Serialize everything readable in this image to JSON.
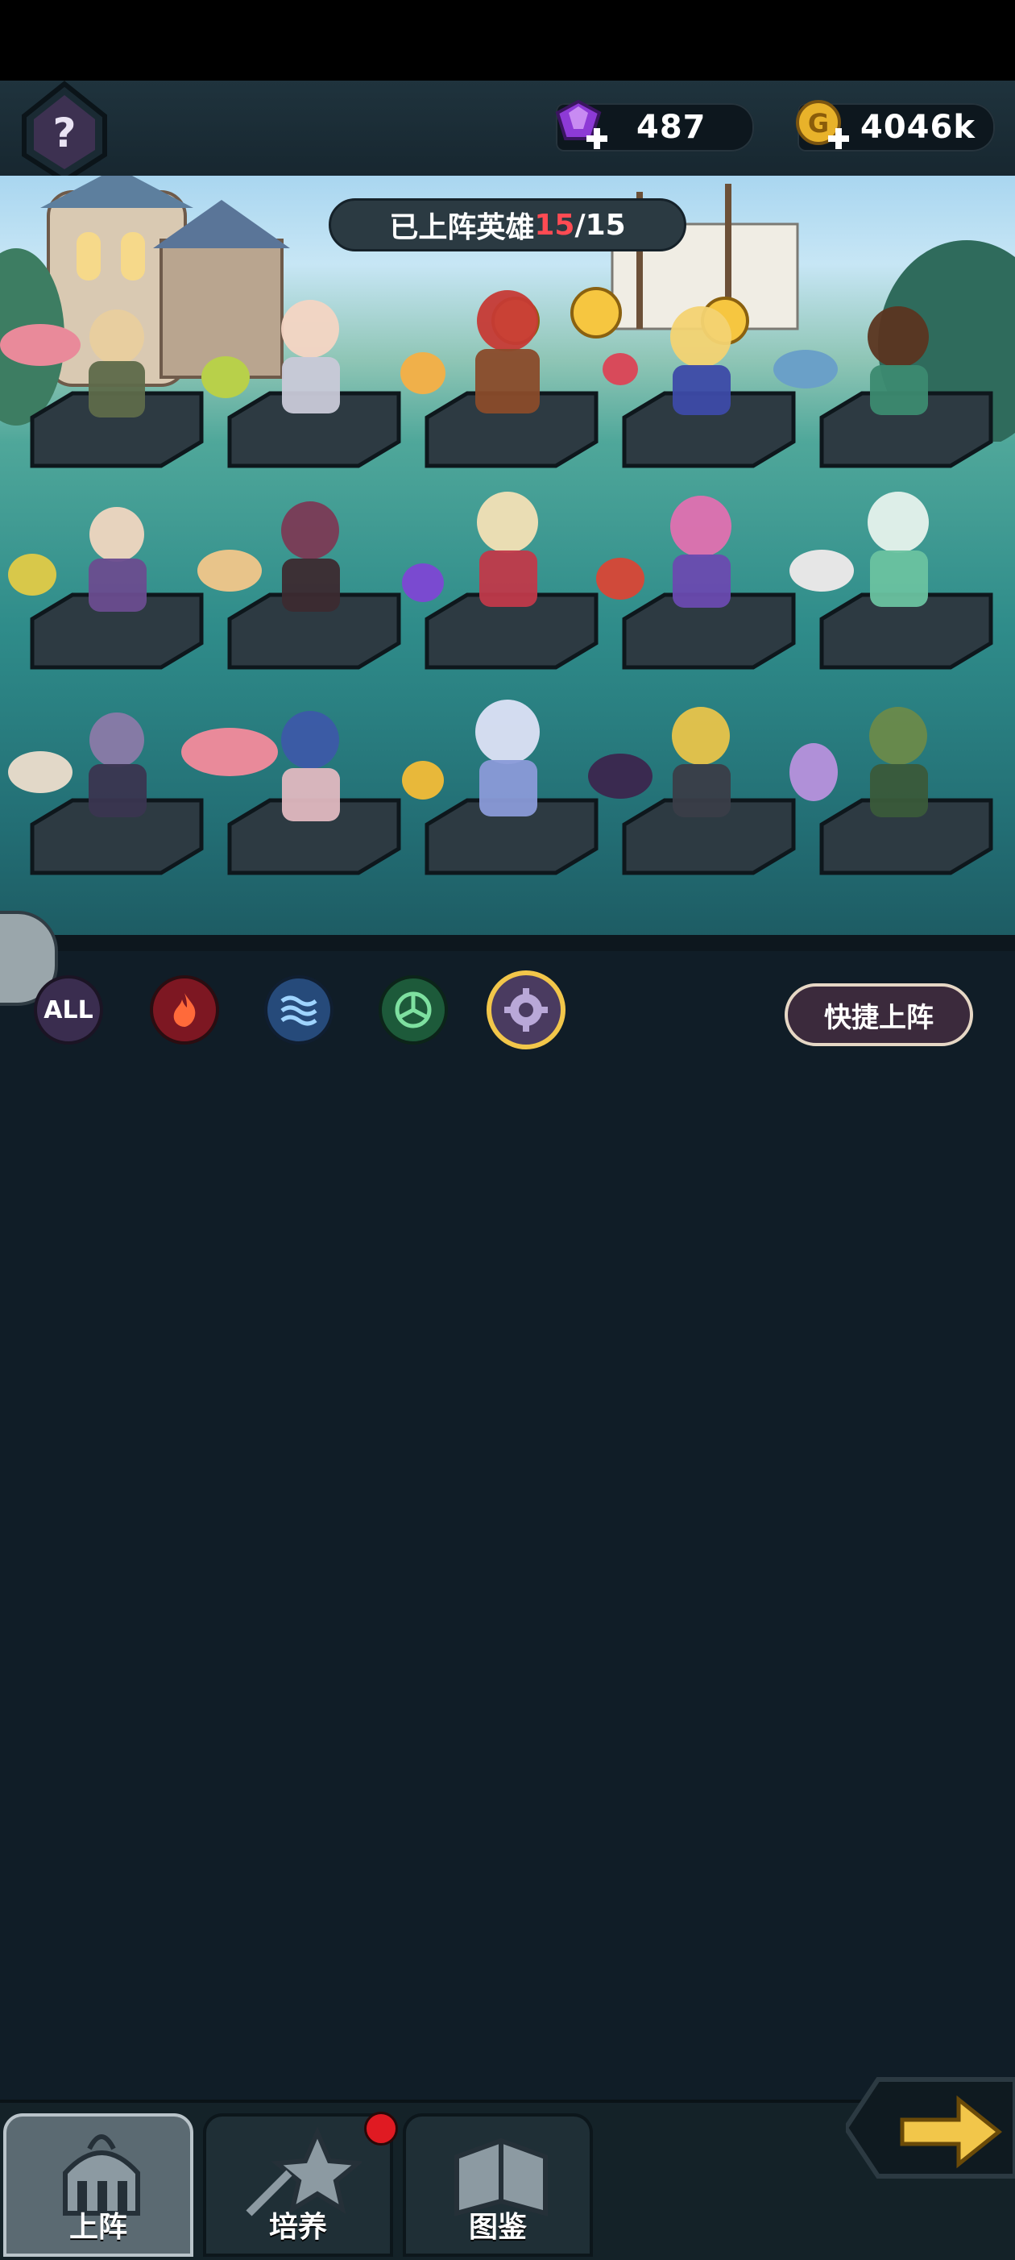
{
  "currency": {
    "gems": "487",
    "gold": "4046k"
  },
  "field": {
    "title_prefix": "已上阵英雄",
    "deployed": "15",
    "title_suffix": "/15"
  },
  "filters": {
    "all_label": "ALL",
    "elements": [
      "fire",
      "water",
      "wind",
      "light"
    ],
    "selected": "light"
  },
  "quick_deploy": "快捷上阵",
  "nav": {
    "tabs": [
      {
        "label": "上阵",
        "icon": "castle-helmet-icon",
        "active": true
      },
      {
        "label": "培养",
        "icon": "upgrade-star-icon",
        "active": false
      },
      {
        "label": "图鉴",
        "icon": "book-icon",
        "active": false
      }
    ]
  },
  "colors": {
    "accent_gold": "#f2c64a",
    "count_red": "#ff4b53",
    "background": "#101d27"
  }
}
